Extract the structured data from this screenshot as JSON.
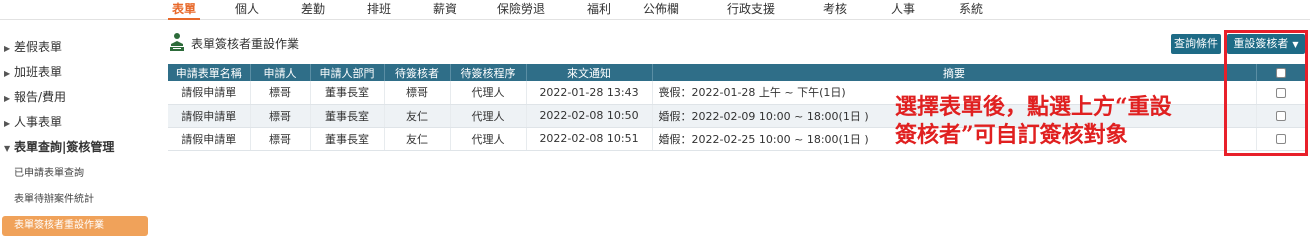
{
  "top_nav": [
    "表單",
    "個人",
    "差勤",
    "排班",
    "薪資",
    "保險勞退",
    "福利",
    "公佈欄",
    "行政支援",
    "考核",
    "人事",
    "系統"
  ],
  "sidebar": {
    "items": [
      "差假表單",
      "加班表單",
      "報告/費用",
      "人事表單",
      "表單查詢|簽核管理"
    ],
    "sub_items": [
      "已申請表單查詢",
      "表單待辦案件統計",
      "表單簽核者重設作業"
    ]
  },
  "main": {
    "title": "表單簽核者重設作業",
    "query_button": "查詢條件",
    "reset_button": "重設簽核者"
  },
  "table": {
    "headers": [
      "申請表單名稱",
      "申請人",
      "申請人部門",
      "待簽核者",
      "待簽核程序",
      "來文通知",
      "摘要",
      ""
    ],
    "rows": [
      [
        "請假申請單",
        "標哥",
        "董事長室",
        "標哥",
        "代理人",
        "2022-01-28 13:43",
        "喪假：2022-01-28 上午 ~ 下午(1日)"
      ],
      [
        "請假申請單",
        "標哥",
        "董事長室",
        "友仁",
        "代理人",
        "2022-02-08 10:50",
        "婚假：2022-02-09 10:00 ~ 18:00(1日 )"
      ],
      [
        "請假申請單",
        "標哥",
        "董事長室",
        "友仁",
        "代理人",
        "2022-02-08 10:51",
        "婚假：2022-02-25 10:00 ~ 18:00(1日 )"
      ]
    ]
  },
  "annotation": {
    "line1": "選擇表單後，點選上方“重設",
    "line2": "簽核者”可自訂簽核對象"
  },
  "colors": {
    "accent": "#e8692a",
    "header": "#2f6e88",
    "button": "#1e6b86",
    "highlight": "#e8202a"
  }
}
